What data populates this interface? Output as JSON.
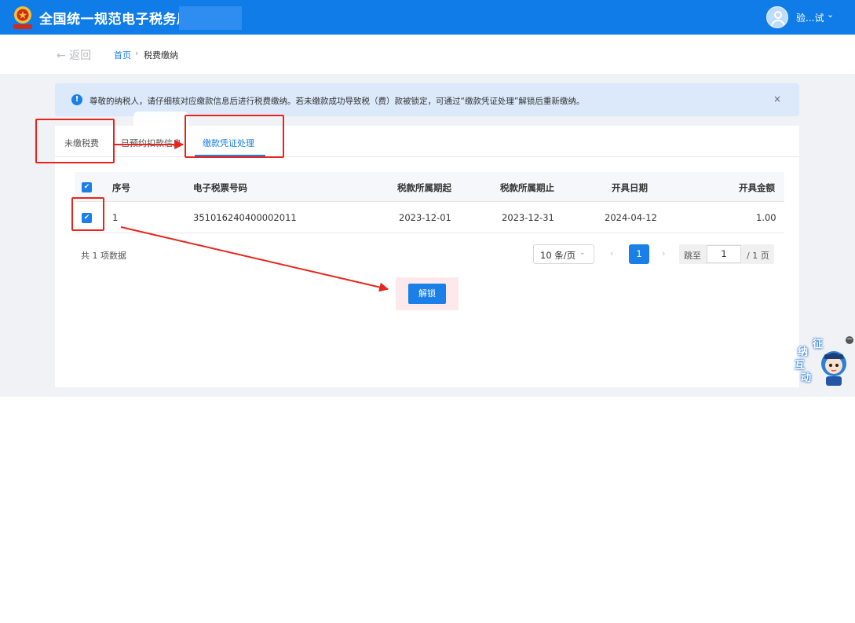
{
  "header": {
    "app_title": "全国统一规范电子税务局",
    "username": "验...试",
    "caret": "⌄"
  },
  "breadcrumb": {
    "back_label": "← 返回",
    "home": "首页",
    "separator": "›",
    "current": "税费缴纳"
  },
  "notice": {
    "icon": "!",
    "text": "尊敬的纳税人，请仔细核对应缴款信息后进行税费缴纳。若未缴款成功导致税（费）款被锁定，可通过“缴款凭证处理”解锁后重新缴纳。",
    "close": "×"
  },
  "tabs": [
    {
      "label": "未缴税费"
    },
    {
      "label": "已预约扣款信息"
    },
    {
      "label": "缴款凭证处理"
    }
  ],
  "table": {
    "columns": [
      "序号",
      "电子税票号码",
      "税款所属期起",
      "税款所属期止",
      "开具日期",
      "开具金额"
    ],
    "rows": [
      {
        "index": "1",
        "ticket_no": "351016240400002011",
        "period_start": "2023-12-01",
        "period_end": "2023-12-31",
        "issue_date": "2024-04-12",
        "amount": "1.00"
      }
    ],
    "check": "✔"
  },
  "pagination": {
    "total": "共 1 项数据",
    "page_size": "10 条/页",
    "page_size_caret": "⌄",
    "prev": "‹",
    "current_page": "1",
    "next": "›",
    "jump_label": "跳至",
    "jump_value": "1",
    "total_pages": "/ 1 页"
  },
  "actions": {
    "unlock": "解锁"
  },
  "mascot": {
    "chars": [
      "征",
      "纳",
      "互",
      "动"
    ],
    "minus": "−"
  },
  "colors": {
    "brand_blue": "#0f7ce8",
    "primary": "#1a7fe8",
    "annotation_red": "#e8251d"
  }
}
